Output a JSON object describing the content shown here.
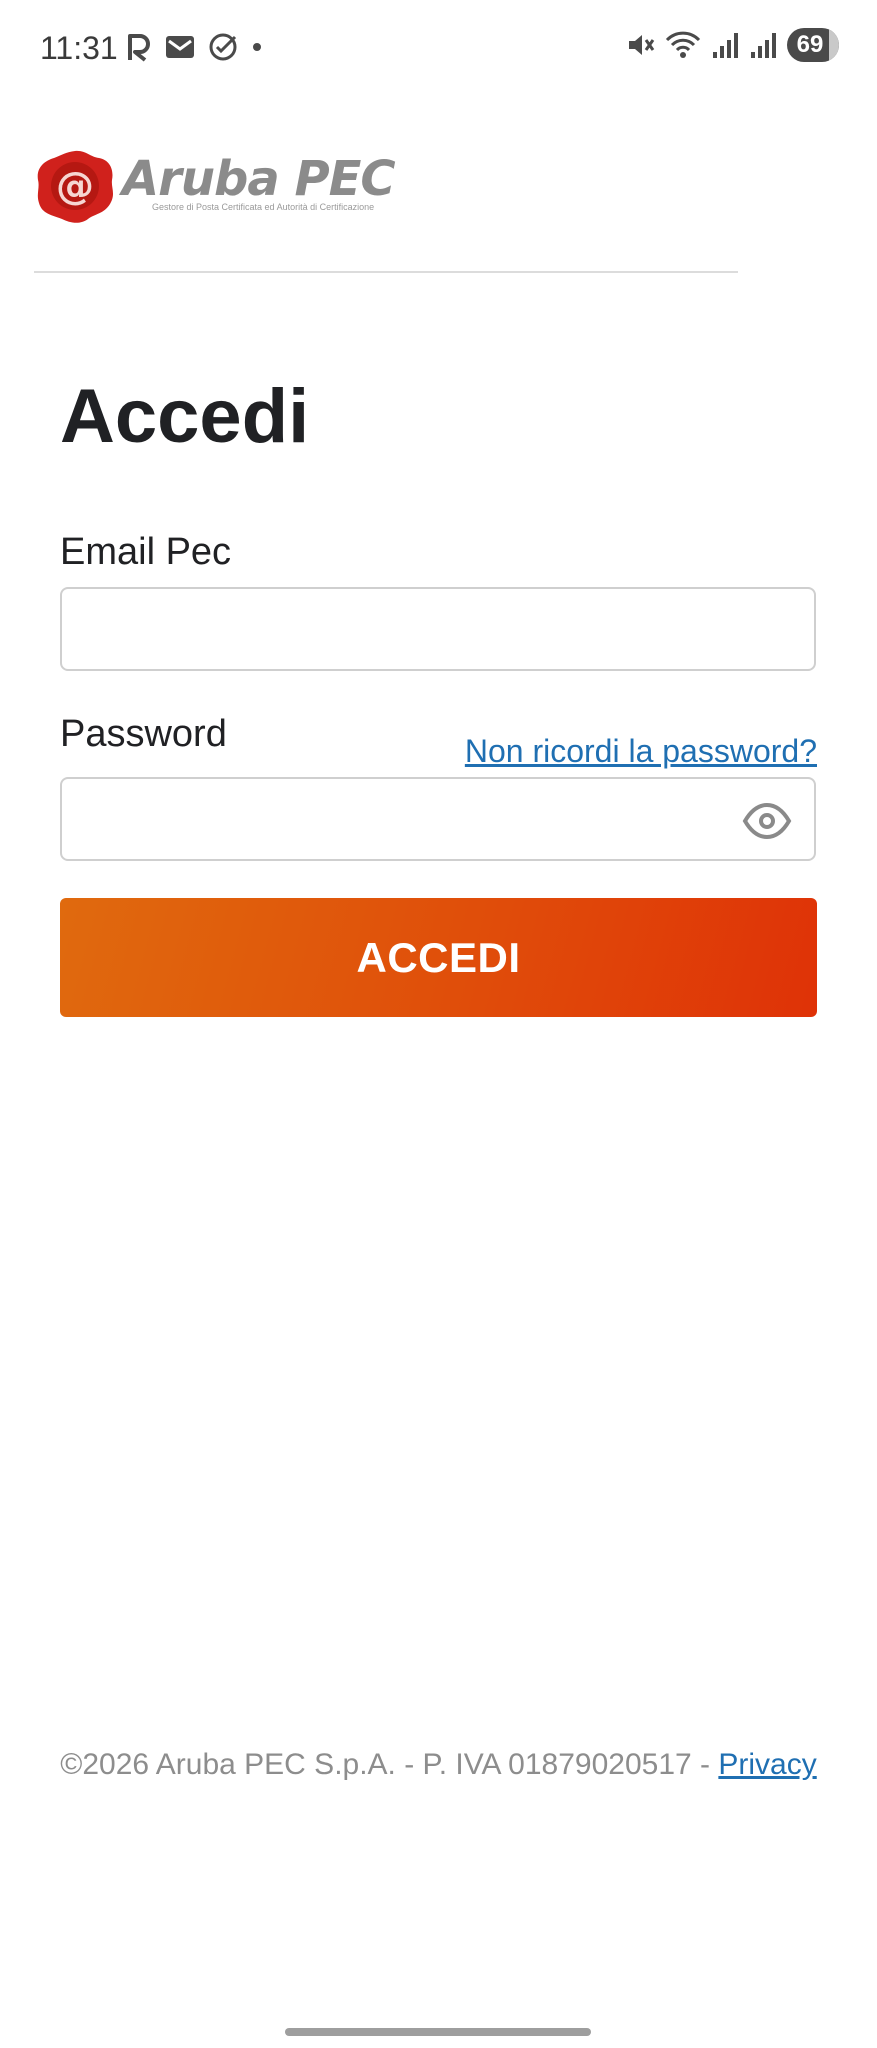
{
  "status_bar": {
    "time": "11:31",
    "left_icons": [
      "r-app-icon",
      "mail-icon",
      "check-circle-icon",
      "dot-icon"
    ],
    "right_icons": [
      "mute-icon",
      "wifi-icon",
      "signal-icon",
      "signal-icon"
    ],
    "battery": "69"
  },
  "header": {
    "logo_name": "Aruba PEC",
    "logo_tagline": "Gestore di Posta Certificata ed Autorità di Certificazione"
  },
  "login": {
    "title": "Accedi",
    "email_label": "Email Pec",
    "email_value": "",
    "password_label": "Password",
    "password_value": "",
    "forgot_password": "Non ricordi la password?",
    "submit_label": "ACCEDI"
  },
  "footer": {
    "copyright": "©2026 Aruba PEC S.p.A. - P. IVA 01879020517 - ",
    "privacy_link": "Privacy"
  },
  "colors": {
    "accent_start": "#e06a0e",
    "accent_end": "#df3207",
    "link": "#1f6fb2",
    "seal_red": "#d0211c"
  }
}
